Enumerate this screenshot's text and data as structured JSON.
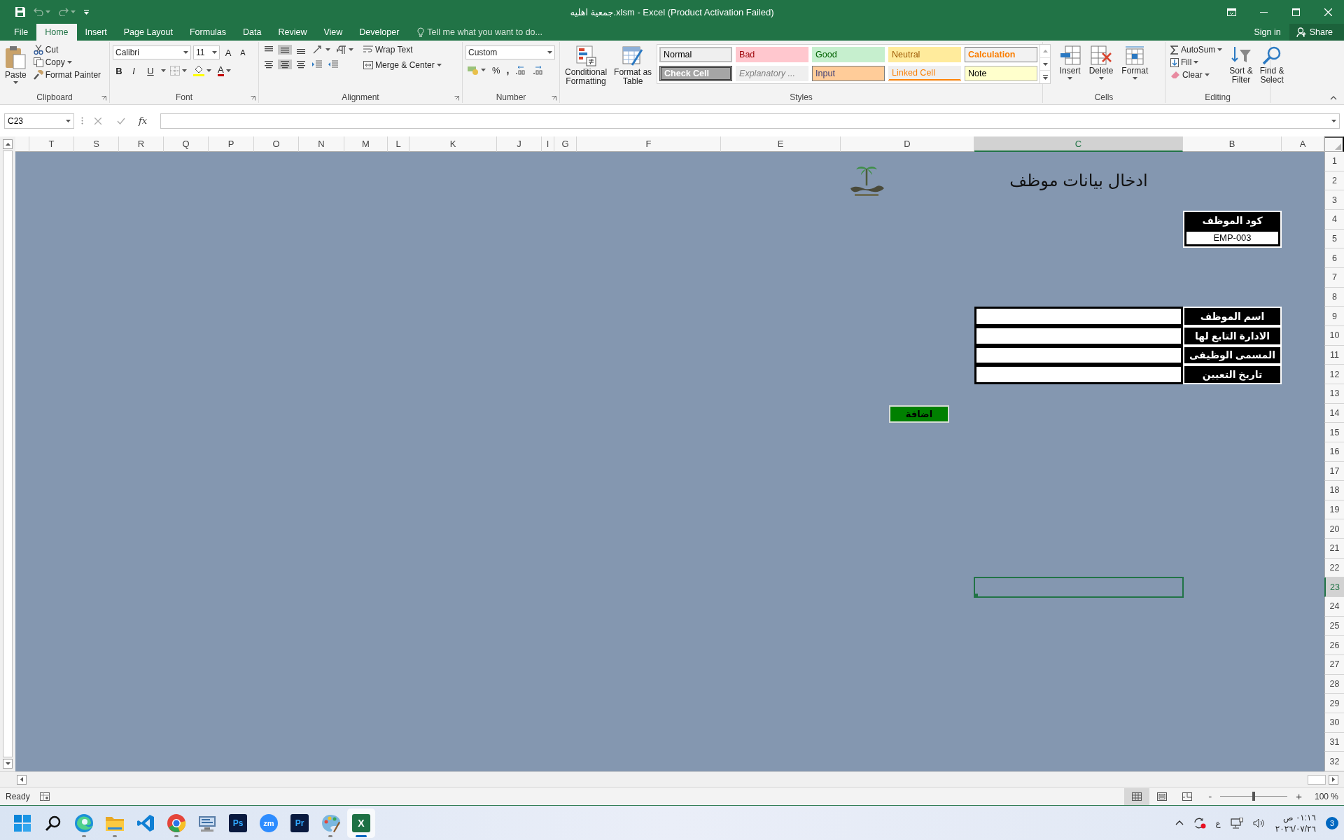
{
  "title_bar": {
    "title": "جمعية اهليه.xlsm - Excel (Product Activation Failed)"
  },
  "ribbon_tabs": [
    {
      "label": "File",
      "selected": false
    },
    {
      "label": "Home",
      "selected": true
    },
    {
      "label": "Insert",
      "selected": false
    },
    {
      "label": "Page Layout",
      "selected": false
    },
    {
      "label": "Formulas",
      "selected": false
    },
    {
      "label": "Data",
      "selected": false
    },
    {
      "label": "Review",
      "selected": false
    },
    {
      "label": "View",
      "selected": false
    },
    {
      "label": "Developer",
      "selected": false
    }
  ],
  "tell_me": {
    "placeholder": "Tell me what you want to do..."
  },
  "account": {
    "sign_in": "Sign in",
    "share": "Share"
  },
  "clipboard": {
    "paste": "Paste",
    "cut": "Cut",
    "copy": "Copy",
    "format_painter": "Format Painter",
    "group": "Clipboard"
  },
  "font": {
    "name": "Calibri",
    "size": "11",
    "grow": "A",
    "shrink": "A",
    "bold": "B",
    "italic": "I",
    "underline": "U",
    "font_color": "A",
    "group": "Font"
  },
  "alignment": {
    "wrap_text": "Wrap Text",
    "merge_center": "Merge & Center",
    "group": "Alignment"
  },
  "number": {
    "format": "Custom",
    "percent": "%",
    "comma": ",",
    "group": "Number"
  },
  "styles": {
    "conditional_formatting": "Conditional\nFormatting",
    "format_as_table": "Format as\nTable",
    "group": "Styles",
    "gallery": [
      {
        "label": "Normal",
        "kind": "normal"
      },
      {
        "label": "Bad",
        "kind": "bad"
      },
      {
        "label": "Good",
        "kind": "good"
      },
      {
        "label": "Neutral",
        "kind": "neutral"
      },
      {
        "label": "Calculation",
        "kind": "calculation"
      },
      {
        "label": "Check Cell",
        "kind": "check"
      },
      {
        "label": "Explanatory ...",
        "kind": "explanatory"
      },
      {
        "label": "Input",
        "kind": "input"
      },
      {
        "label": "Linked Cell",
        "kind": "linked"
      },
      {
        "label": "Note",
        "kind": "note"
      }
    ]
  },
  "cells": {
    "group": "Cells",
    "buttons": [
      {
        "label": "Insert",
        "kind": "insert"
      },
      {
        "label": "Delete",
        "kind": "delete"
      },
      {
        "label": "Format",
        "kind": "format"
      }
    ]
  },
  "editing": {
    "autosum": "AutoSum",
    "fill": "Fill",
    "clear": "Clear",
    "sort_filter": "Sort &\nFilter",
    "find_select": "Find &\nSelect",
    "group": "Editing"
  },
  "formula_bar": {
    "name_box": "C23",
    "fx": "fx"
  },
  "sheet": {
    "columns": [
      {
        "label": "T",
        "selected": false
      },
      {
        "label": "S",
        "selected": false
      },
      {
        "label": "R",
        "selected": false
      },
      {
        "label": "Q",
        "selected": false
      },
      {
        "label": "P",
        "selected": false
      },
      {
        "label": "O",
        "selected": false
      },
      {
        "label": "N",
        "selected": false
      },
      {
        "label": "M",
        "selected": false
      },
      {
        "label": "L",
        "selected": false
      },
      {
        "label": "K",
        "selected": false
      },
      {
        "label": "J",
        "selected": false
      },
      {
        "label": "I",
        "selected": false
      },
      {
        "label": "G",
        "selected": false
      },
      {
        "label": "F",
        "selected": false
      },
      {
        "label": "E",
        "selected": false
      },
      {
        "label": "D",
        "selected": false
      },
      {
        "label": "C",
        "selected": true
      },
      {
        "label": "B",
        "selected": false
      },
      {
        "label": "A",
        "selected": false
      }
    ],
    "rows": [
      {
        "label": "1",
        "selected": false
      },
      {
        "label": "2",
        "selected": false
      },
      {
        "label": "3",
        "selected": false
      },
      {
        "label": "4",
        "selected": false
      },
      {
        "label": "5",
        "selected": false
      },
      {
        "label": "6",
        "selected": false
      },
      {
        "label": "7",
        "selected": false
      },
      {
        "label": "8",
        "selected": false
      },
      {
        "label": "9",
        "selected": false
      },
      {
        "label": "10",
        "selected": false
      },
      {
        "label": "11",
        "selected": false
      },
      {
        "label": "12",
        "selected": false
      },
      {
        "label": "13",
        "selected": false
      },
      {
        "label": "14",
        "selected": false
      },
      {
        "label": "15",
        "selected": false
      },
      {
        "label": "16",
        "selected": false
      },
      {
        "label": "17",
        "selected": false
      },
      {
        "label": "18",
        "selected": false
      },
      {
        "label": "19",
        "selected": false
      },
      {
        "label": "20",
        "selected": false
      },
      {
        "label": "21",
        "selected": false
      },
      {
        "label": "22",
        "selected": false
      },
      {
        "label": "23",
        "selected": true
      },
      {
        "label": "24",
        "selected": false
      },
      {
        "label": "25",
        "selected": false
      },
      {
        "label": "26",
        "selected": false
      },
      {
        "label": "27",
        "selected": false
      },
      {
        "label": "28",
        "selected": false
      },
      {
        "label": "29",
        "selected": false
      },
      {
        "label": "30",
        "selected": false
      },
      {
        "label": "31",
        "selected": false
      },
      {
        "label": "32",
        "selected": false
      }
    ],
    "title": "ادخال بيانات موظف",
    "employee_code": {
      "label": "كود الموظف",
      "value": "EMP-003"
    },
    "form_fields": [
      {
        "label": "اسم الموظف"
      },
      {
        "label": "الادارة التابع لها"
      },
      {
        "label": "المسمى الوظيفى"
      },
      {
        "label": "تاريخ التعيين"
      }
    ],
    "add_button": "اضافة"
  },
  "status_bar": {
    "status": "Ready",
    "views": [
      {
        "kind": "normal",
        "selected": true
      },
      {
        "kind": "page_layout",
        "selected": false
      },
      {
        "kind": "page_break",
        "selected": false
      }
    ],
    "zoom_out": "-",
    "zoom_slider": {
      "level": 0.5
    },
    "zoom_in": "+",
    "zoom": "100 %"
  },
  "taskbar": {
    "apps": [
      {
        "kind": "start",
        "running": false,
        "selected": false
      },
      {
        "kind": "search",
        "running": false,
        "selected": false
      },
      {
        "kind": "edge",
        "running": true,
        "selected": false
      },
      {
        "kind": "folder",
        "running": true,
        "selected": false
      },
      {
        "kind": "code",
        "running": false,
        "selected": false
      },
      {
        "kind": "chrome",
        "running": true,
        "selected": false
      },
      {
        "kind": "remote",
        "running": false,
        "selected": false
      },
      {
        "kind": "tile",
        "label": "Ps",
        "running": false,
        "selected": false
      },
      {
        "kind": "round",
        "label": "zm",
        "running": false,
        "selected": false
      },
      {
        "kind": "tile",
        "label": "Pr",
        "running": false,
        "selected": false
      },
      {
        "kind": "paint",
        "running": true,
        "selected": false
      },
      {
        "kind": "excel",
        "label": "X",
        "running": true,
        "selected": true
      }
    ],
    "tray": {
      "language": "ع",
      "time": "٠١:١٦ ص",
      "date": "٢٠٢٦/٠٧/٢٦",
      "notifications": "3"
    }
  }
}
